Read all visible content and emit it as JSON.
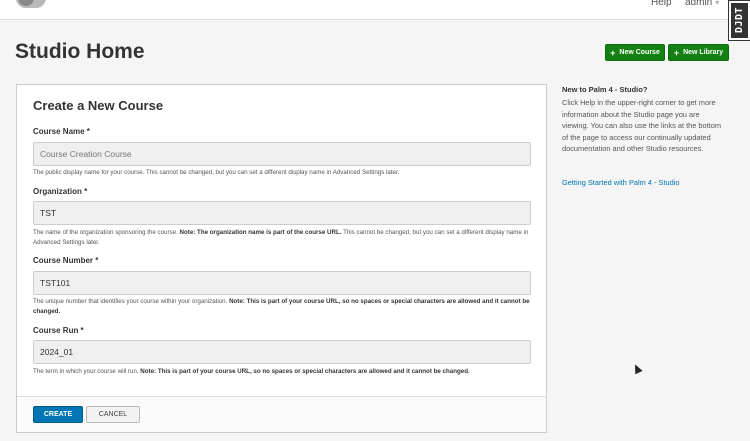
{
  "topbar": {
    "help_label": "Help",
    "user_label": "admin"
  },
  "debug_toolbar": {
    "label": "DJDT"
  },
  "header": {
    "title": "Studio Home",
    "new_course_label": "New Course",
    "new_library_label": "New Library"
  },
  "form": {
    "title": "Create a New Course",
    "course_name": {
      "label": "Course Name *",
      "placeholder": "Course Creation Course",
      "help": "The public display name for your course. This cannot be changed, but you can set a different display name in Advanced Settings later."
    },
    "organization": {
      "label": "Organization *",
      "value": "TST",
      "help_prefix": "The name of the organization sponsoring the course. ",
      "help_bold": "Note: The organization name is part of the course URL.",
      "help_suffix": " This cannot be changed, but you can set a different display name in Advanced Settings later."
    },
    "course_number": {
      "label": "Course Number *",
      "value": "TST101",
      "help_prefix": "The unique number that identifies your course within your organization. ",
      "help_bold": "Note: This is part of your course URL, so no spaces or special characters are allowed and it cannot be changed."
    },
    "course_run": {
      "label": "Course Run *",
      "value": "2024_01",
      "help_prefix": "The term in which your course will run. ",
      "help_bold": "Note: This is part of your course URL, so no spaces or special characters are allowed and it cannot be changed."
    },
    "create_label": "CREATE",
    "cancel_label": "CANCEL"
  },
  "sidebar": {
    "heading": "New to Palm 4 - Studio?",
    "text": "Click Help in the upper-right corner to get more information about the Studio page you are viewing. You can also use the links at the bottom of the page to access our continually updated documentation and other Studio resources.",
    "link": "Getting Started with Palm 4 - Studio"
  },
  "colors": {
    "green_button": "#128112",
    "create_button": "#0075b4",
    "link": "#0075b4"
  }
}
